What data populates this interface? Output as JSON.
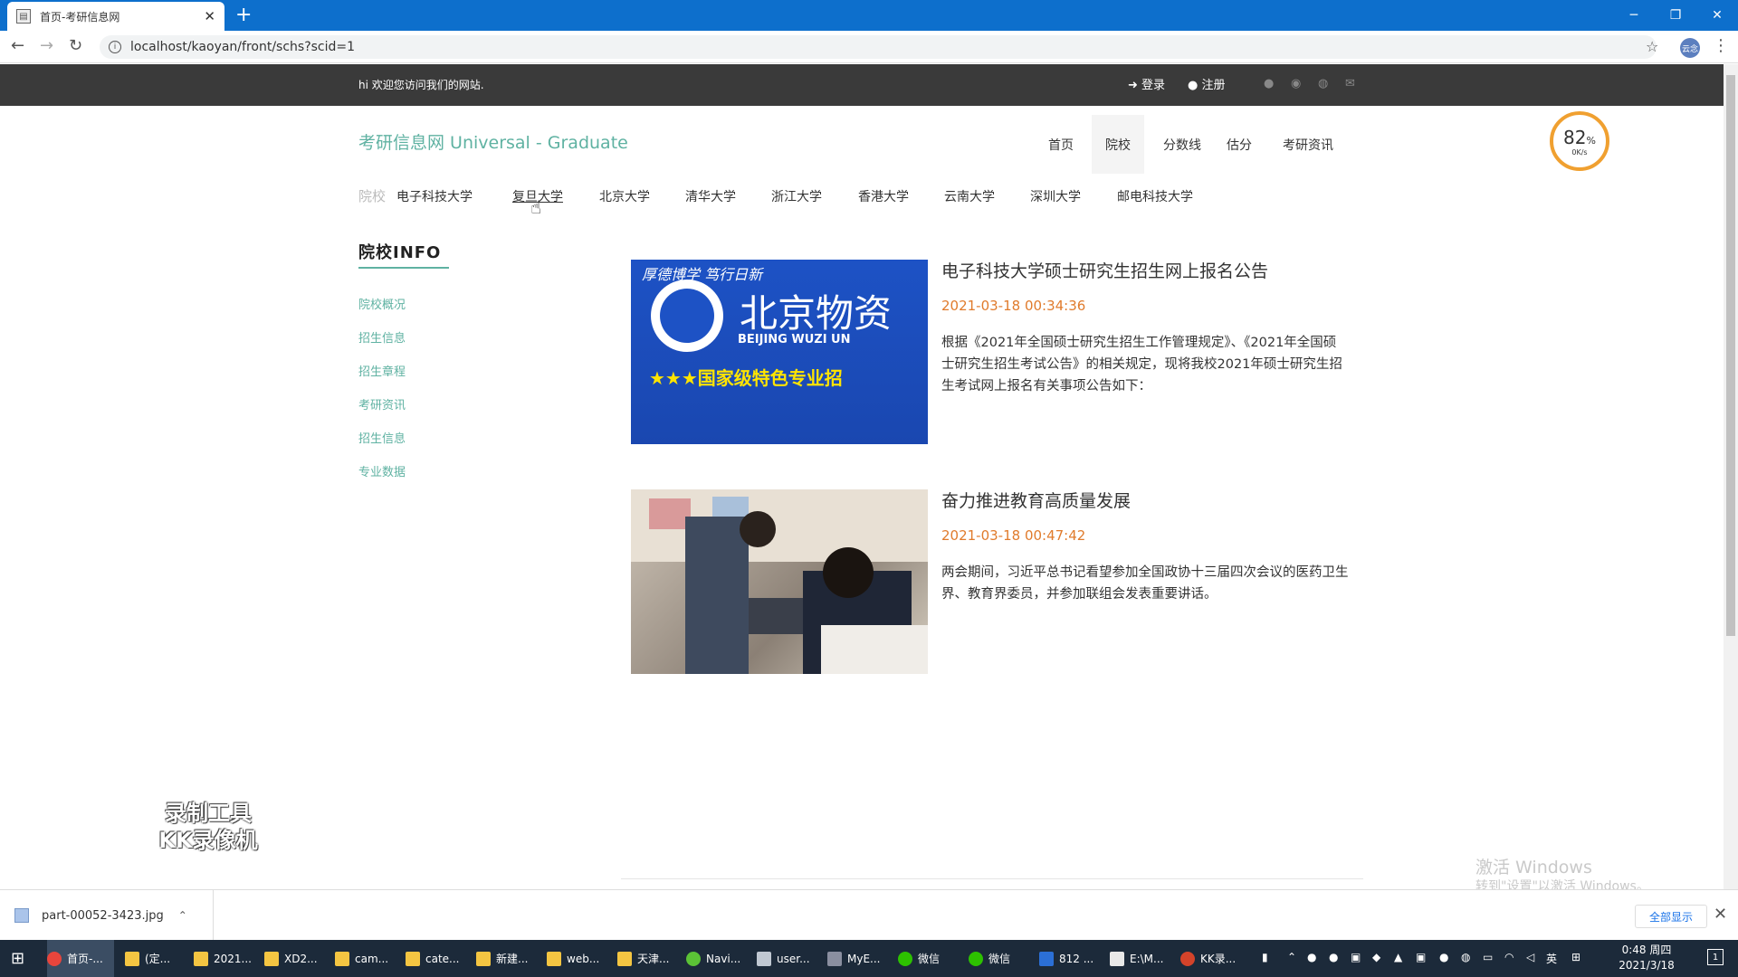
{
  "browser": {
    "tab_title": "首页-考研信息网",
    "url": "localhost/kaoyan/front/schs?scid=1",
    "profile_label": "云念"
  },
  "topbar": {
    "welcome": "hi 欢迎您访问我们的网站.",
    "login": "登录",
    "register": "注册"
  },
  "brand": "考研信息网 Universal - Graduate",
  "mainnav": [
    "首页",
    "院校",
    "分数线",
    "估分",
    "考研资讯"
  ],
  "speed": {
    "percent": "82",
    "unit": "%",
    "rate": "0K/s"
  },
  "schools": {
    "label": "院校",
    "items": [
      "电子科技大学",
      "复旦大学",
      "北京大学",
      "清华大学",
      "浙江大学",
      "香港大学",
      "云南大学",
      "深圳大学",
      "邮电科技大学"
    ]
  },
  "sidebar": {
    "heading": "院校INFO",
    "links": [
      "院校概况",
      "招生信息",
      "招生章程",
      "考研资讯",
      "招生信息",
      "专业数据"
    ]
  },
  "articles": [
    {
      "title": "电子科技大学硕士研究生招生网上报名公告",
      "date": "2021-03-18 00:34:36",
      "summary": "根据《2021年全国硕士研究生招生工作管理规定》、《2021年全国硕士研究生招生考试公告》的相关规定，现将我校2021年硕士研究生招生考试网上报名有关事项公告如下：",
      "image_text": {
        "line1": "厚德博学 笃行日新",
        "line2": "北京物资",
        "line3": "BEIJING WUZI UN",
        "line4": "★★★国家级特色专业招"
      }
    },
    {
      "title": "奋力推进教育高质量发展",
      "date": "2021-03-18 00:47:42",
      "summary": "两会期间，习近平总书记看望参加全国政协十三届四次会议的医药卫生界、教育界委员，并参加联组会发表重要讲话。"
    }
  ],
  "watermark_kk": "录制工具 KK录像机",
  "windows_activation": {
    "line1": "激活 Windows",
    "line2": "转到\"设置\"以激活 Windows。"
  },
  "download": {
    "file": "part-00052-3423.jpg",
    "show_all": "全部显示"
  },
  "taskbar": {
    "items": [
      "首页-...",
      "(定...",
      "2021...",
      "XD2...",
      "cam...",
      "cate...",
      "新建...",
      "web...",
      "天津...",
      "Navi...",
      "user...",
      "MyE...",
      "微信",
      "微信",
      "812 ...",
      "E:\\M...",
      "KK录..."
    ],
    "ime": "英",
    "time": "0:48 周四",
    "date": "2021/3/18",
    "notif_count": "1"
  },
  "colors": {
    "accent": "#5fb2a2",
    "date": "#e07b2c",
    "topbar": "#3a3a3a",
    "chrome": "#0d6fcc"
  }
}
